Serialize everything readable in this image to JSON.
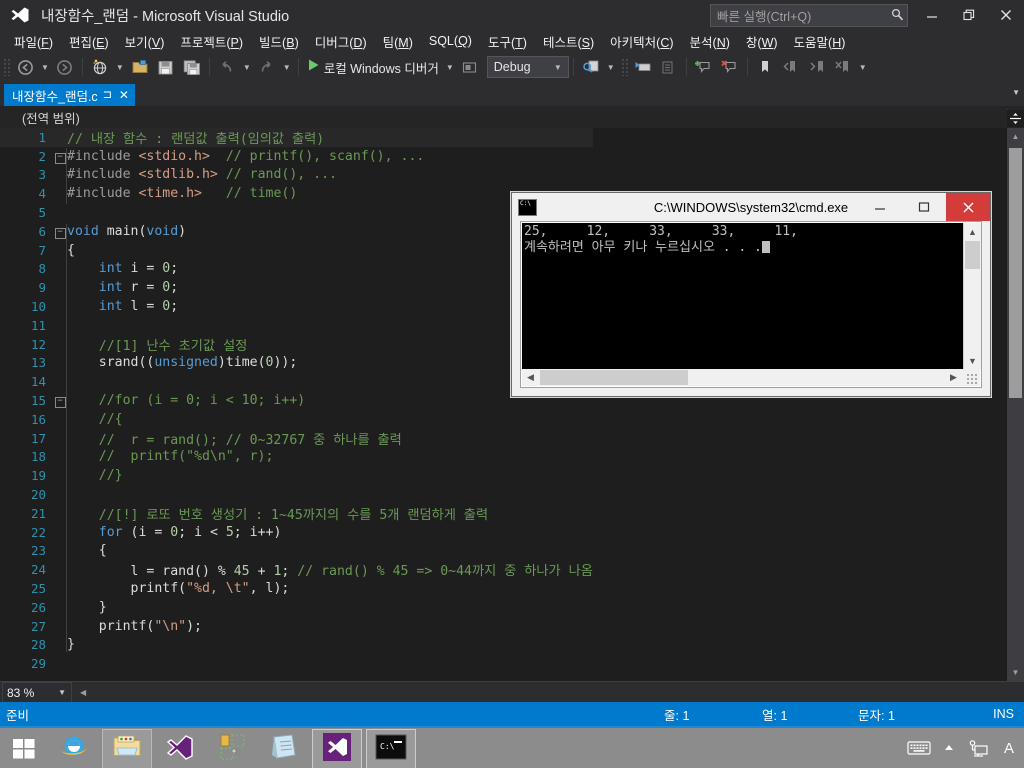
{
  "window": {
    "title": "내장함수_랜덤 - Microsoft Visual Studio",
    "logo_icon": "visual-studio-logo",
    "quick_launch_placeholder": "빠른 실행(Ctrl+Q)",
    "quick_launch_value": "",
    "search_icon": "search-icon",
    "minimize_label": "최소화",
    "restore_label": "이전 크기로 복원",
    "close_label": "닫기"
  },
  "menu": {
    "items": [
      {
        "label": "파일(F)",
        "mnemonic": "F"
      },
      {
        "label": "편집(E)",
        "mnemonic": "E"
      },
      {
        "label": "보기(V)",
        "mnemonic": "V"
      },
      {
        "label": "프로젝트(P)",
        "mnemonic": "P"
      },
      {
        "label": "빌드(B)",
        "mnemonic": "B"
      },
      {
        "label": "디버그(D)",
        "mnemonic": "D"
      },
      {
        "label": "팀(M)",
        "mnemonic": "M"
      },
      {
        "label": "SQL(Q)",
        "mnemonic": "Q"
      },
      {
        "label": "도구(T)",
        "mnemonic": "T"
      },
      {
        "label": "테스트(S)",
        "mnemonic": "S"
      },
      {
        "label": "아키텍처(C)",
        "mnemonic": "C"
      },
      {
        "label": "분석(N)",
        "mnemonic": "N"
      },
      {
        "label": "창(W)",
        "mnemonic": "W"
      },
      {
        "label": "도움말(H)",
        "mnemonic": "H"
      }
    ]
  },
  "toolbar": {
    "nav_back_icon": "navigate-backward-icon",
    "nav_forward_icon": "navigate-forward-icon",
    "new_project_icon": "new-project-icon",
    "open_file_icon": "open-file-icon",
    "save_icon": "save-icon",
    "save_all_icon": "save-all-icon",
    "undo_icon": "undo-icon",
    "redo_icon": "redo-icon",
    "run_icon": "start-debug-icon",
    "run_label": "로컬 Windows 디버거",
    "config_icon": "solution-config-icon",
    "config_value": "Debug",
    "find_icon": "find-in-files-icon",
    "comment_icon": "comment-selection-icon",
    "uncomment_icon": "uncomment-selection-icon",
    "add_breakpoint_icon": "toggle-breakpoint-icon",
    "delete_breakpoint_icon": "delete-breakpoint-icon",
    "bookmark_icon": "bookmark-icon",
    "prev_bookmark_icon": "previous-bookmark-icon",
    "next_bookmark_icon": "next-bookmark-icon",
    "clear_bookmark_icon": "clear-bookmarks-icon",
    "overflow_icon": "toolbar-overflow-icon"
  },
  "tab": {
    "filename": "내장함수_랜덤.c",
    "pin_icon": "pin-icon",
    "close_icon": "close-icon",
    "dropdown_icon": "chevron-down-icon"
  },
  "navbar": {
    "scope": "(전역 범위)",
    "dropdown_icon": "chevron-down-icon"
  },
  "editor": {
    "zoom": "83 %",
    "zoom_caret_icon": "chevron-down-icon",
    "hscroll_left_icon": "chevron-left-icon",
    "vscroll_up_icon": "chevron-up-icon",
    "vscroll_down_icon": "chevron-down-icon",
    "splitter_icon": "split-view-icon",
    "lines": [
      {
        "n": 1,
        "fold": "",
        "current": true,
        "tokens": [
          {
            "t": "// 내장 함수 : 랜덤값 출력(임의값 출력)",
            "c": "cm"
          }
        ]
      },
      {
        "n": 2,
        "fold": "−",
        "current": false,
        "tokens": [
          {
            "t": "#include ",
            "c": "pp"
          },
          {
            "t": "<stdio.h>",
            "c": "ppinc"
          },
          {
            "t": "  ",
            "c": ""
          },
          {
            "t": "// printf(), scanf(), ...",
            "c": "cm"
          }
        ]
      },
      {
        "n": 3,
        "fold": "",
        "current": false,
        "tokens": [
          {
            "t": "#include ",
            "c": "pp"
          },
          {
            "t": "<stdlib.h>",
            "c": "ppinc"
          },
          {
            "t": " ",
            "c": ""
          },
          {
            "t": "// rand(), ...",
            "c": "cm"
          }
        ]
      },
      {
        "n": 4,
        "fold": "",
        "current": false,
        "tokens": [
          {
            "t": "#include ",
            "c": "pp"
          },
          {
            "t": "<time.h>",
            "c": "ppinc"
          },
          {
            "t": "   ",
            "c": ""
          },
          {
            "t": "// time()",
            "c": "cm"
          }
        ]
      },
      {
        "n": 5,
        "fold": "",
        "current": false,
        "tokens": []
      },
      {
        "n": 6,
        "fold": "−",
        "current": false,
        "tokens": [
          {
            "t": "void",
            "c": "kw"
          },
          {
            "t": " main(",
            "c": ""
          },
          {
            "t": "void",
            "c": "kw"
          },
          {
            "t": ")",
            "c": ""
          }
        ]
      },
      {
        "n": 7,
        "fold": "",
        "current": false,
        "tokens": [
          {
            "t": "{",
            "c": ""
          }
        ]
      },
      {
        "n": 8,
        "fold": "",
        "current": false,
        "tokens": [
          {
            "t": "    ",
            "c": ""
          },
          {
            "t": "int",
            "c": "kw"
          },
          {
            "t": " i = ",
            "c": ""
          },
          {
            "t": "0",
            "c": "num"
          },
          {
            "t": ";",
            "c": ""
          }
        ]
      },
      {
        "n": 9,
        "fold": "",
        "current": false,
        "tokens": [
          {
            "t": "    ",
            "c": ""
          },
          {
            "t": "int",
            "c": "kw"
          },
          {
            "t": " r = ",
            "c": ""
          },
          {
            "t": "0",
            "c": "num"
          },
          {
            "t": ";",
            "c": ""
          }
        ]
      },
      {
        "n": 10,
        "fold": "",
        "current": false,
        "tokens": [
          {
            "t": "    ",
            "c": ""
          },
          {
            "t": "int",
            "c": "kw"
          },
          {
            "t": " l = ",
            "c": ""
          },
          {
            "t": "0",
            "c": "num"
          },
          {
            "t": ";",
            "c": ""
          }
        ]
      },
      {
        "n": 11,
        "fold": "",
        "current": false,
        "tokens": []
      },
      {
        "n": 12,
        "fold": "",
        "current": false,
        "tokens": [
          {
            "t": "    ",
            "c": ""
          },
          {
            "t": "//[1] 난수 초기값 설정",
            "c": "cm"
          }
        ]
      },
      {
        "n": 13,
        "fold": "",
        "current": false,
        "tokens": [
          {
            "t": "    srand((",
            "c": ""
          },
          {
            "t": "unsigned",
            "c": "kw"
          },
          {
            "t": ")time(",
            "c": ""
          },
          {
            "t": "0",
            "c": "num"
          },
          {
            "t": "));",
            "c": ""
          }
        ]
      },
      {
        "n": 14,
        "fold": "",
        "current": false,
        "tokens": []
      },
      {
        "n": 15,
        "fold": "−",
        "current": false,
        "tokens": [
          {
            "t": "    ",
            "c": ""
          },
          {
            "t": "//for (i = 0; i < 10; i++)",
            "c": "cm"
          }
        ]
      },
      {
        "n": 16,
        "fold": "",
        "current": false,
        "tokens": [
          {
            "t": "    ",
            "c": ""
          },
          {
            "t": "//{",
            "c": "cm"
          }
        ]
      },
      {
        "n": 17,
        "fold": "",
        "current": false,
        "tokens": [
          {
            "t": "    ",
            "c": ""
          },
          {
            "t": "//  r = rand(); // 0~32767 중 하나를 출력",
            "c": "cm"
          }
        ]
      },
      {
        "n": 18,
        "fold": "",
        "current": false,
        "tokens": [
          {
            "t": "    ",
            "c": ""
          },
          {
            "t": "//  printf(\"%d\\n\", r);",
            "c": "cm"
          }
        ]
      },
      {
        "n": 19,
        "fold": "",
        "current": false,
        "tokens": [
          {
            "t": "    ",
            "c": ""
          },
          {
            "t": "//}",
            "c": "cm"
          }
        ]
      },
      {
        "n": 20,
        "fold": "",
        "current": false,
        "tokens": []
      },
      {
        "n": 21,
        "fold": "",
        "current": false,
        "tokens": [
          {
            "t": "    ",
            "c": ""
          },
          {
            "t": "//[!] 로또 번호 생성기 : 1~45까지의 수를 5개 랜덤하게 출력",
            "c": "cm"
          }
        ]
      },
      {
        "n": 22,
        "fold": "",
        "current": false,
        "tokens": [
          {
            "t": "    ",
            "c": ""
          },
          {
            "t": "for",
            "c": "kw"
          },
          {
            "t": " (i = ",
            "c": ""
          },
          {
            "t": "0",
            "c": "num"
          },
          {
            "t": "; i < ",
            "c": ""
          },
          {
            "t": "5",
            "c": "num"
          },
          {
            "t": "; i++)",
            "c": ""
          }
        ]
      },
      {
        "n": 23,
        "fold": "",
        "current": false,
        "tokens": [
          {
            "t": "    {",
            "c": ""
          }
        ]
      },
      {
        "n": 24,
        "fold": "",
        "current": false,
        "tokens": [
          {
            "t": "        l = rand() % ",
            "c": ""
          },
          {
            "t": "45",
            "c": "num"
          },
          {
            "t": " + ",
            "c": ""
          },
          {
            "t": "1",
            "c": "num"
          },
          {
            "t": "; ",
            "c": ""
          },
          {
            "t": "// rand() % 45 => 0~44까지 중 하나가 나옴",
            "c": "cm"
          }
        ]
      },
      {
        "n": 25,
        "fold": "",
        "current": false,
        "tokens": [
          {
            "t": "        printf(",
            "c": ""
          },
          {
            "t": "\"%d, \\t\"",
            "c": "st"
          },
          {
            "t": ", l);",
            "c": ""
          }
        ]
      },
      {
        "n": 26,
        "fold": "",
        "current": false,
        "tokens": [
          {
            "t": "    }",
            "c": ""
          }
        ]
      },
      {
        "n": 27,
        "fold": "",
        "current": false,
        "tokens": [
          {
            "t": "    printf(",
            "c": ""
          },
          {
            "t": "\"\\n\"",
            "c": "st"
          },
          {
            "t": ");",
            "c": ""
          }
        ]
      },
      {
        "n": 28,
        "fold": "",
        "current": false,
        "tokens": [
          {
            "t": "}",
            "c": ""
          }
        ]
      },
      {
        "n": 29,
        "fold": "",
        "current": false,
        "tokens": []
      }
    ]
  },
  "status": {
    "ready": "준비",
    "line_label": "줄: 1",
    "col_label": "열: 1",
    "char_label": "문자: 1",
    "insert_mode": "INS"
  },
  "console": {
    "icon": "cmd-console-icon",
    "title": "C:\\WINDOWS\\system32\\cmd.exe",
    "output_line1": "25,     12,     33,     33,     11,",
    "output_line2": "계속하려면 아무 키나 누르십시오 . . .",
    "minimize_icon": "minimize-icon",
    "maximize_icon": "maximize-icon",
    "close_icon": "close-icon",
    "vscroll_up_icon": "chevron-up-icon",
    "vscroll_down_icon": "chevron-down-icon",
    "hscroll_left_icon": "chevron-left-icon",
    "hscroll_right_icon": "chevron-right-icon",
    "resize_grip_icon": "resize-grip-icon"
  },
  "taskbar": {
    "start_icon": "windows-start-icon",
    "items": [
      {
        "icon": "internet-explorer-icon",
        "name": "internet-explorer",
        "boxed": false,
        "active": false
      },
      {
        "icon": "file-explorer-icon",
        "name": "file-explorer",
        "boxed": true,
        "active": false
      },
      {
        "icon": "visual-studio-icon",
        "name": "visual-studio-shortcut",
        "boxed": false,
        "active": false
      },
      {
        "icon": "resource-tools-icon",
        "name": "resource-tools",
        "boxed": false,
        "active": false
      },
      {
        "icon": "notepad-icon",
        "name": "notepad",
        "boxed": false,
        "active": false
      },
      {
        "icon": "visual-studio-icon",
        "name": "visual-studio-window",
        "boxed": true,
        "active": true
      },
      {
        "icon": "cmd-console-icon",
        "name": "cmd-console-window",
        "boxed": true,
        "active": true
      }
    ],
    "tray": [
      {
        "icon": "keyboard-icon",
        "name": "touch-keyboard"
      },
      {
        "icon": "show-hidden-icons-icon",
        "name": "show-hidden-icons"
      },
      {
        "icon": "network-icon",
        "name": "network"
      },
      {
        "icon": "ime-icon",
        "name": "ime-indicator",
        "glyph": "A"
      }
    ]
  },
  "colors": {
    "accent": "#007acc",
    "chrome": "#2d2d30",
    "editor_bg": "#1e1e1e",
    "comment": "#6a9955",
    "keyword": "#569cd6",
    "string": "#d69d85",
    "number": "#b5cea8",
    "close_red": "#d63b3b"
  }
}
